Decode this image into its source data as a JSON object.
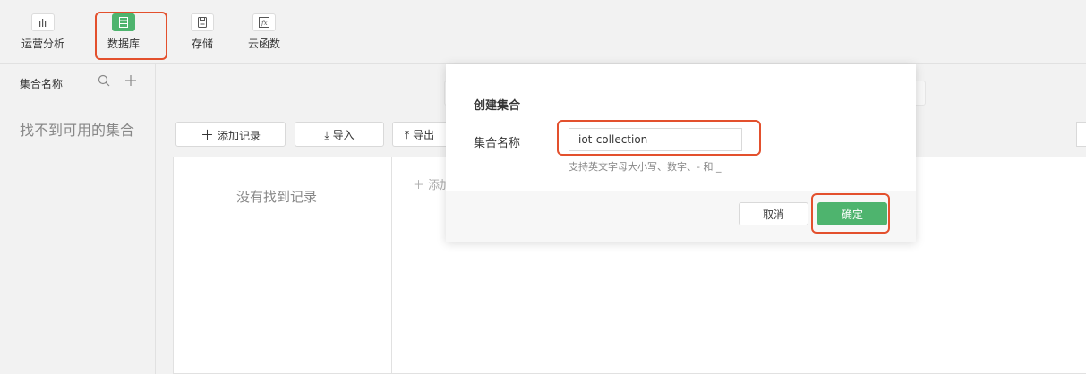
{
  "toolbar": {
    "items": [
      {
        "label": "运营分析",
        "icon": "chart-bars-icon"
      },
      {
        "label": "数据库",
        "icon": "database-icon",
        "active": true
      },
      {
        "label": "存储",
        "icon": "save-disk-icon"
      },
      {
        "label": "云函数",
        "icon": "function-fx-icon"
      }
    ],
    "fx_glyph": "fx"
  },
  "sidebar": {
    "title": "集合名称",
    "empty_text": "找不到可用的集合"
  },
  "main": {
    "add_record_label": "添加记录",
    "import_label": "导入",
    "export_label": "导出",
    "empty_records_text": "没有找到记录",
    "add_field_label": "添加"
  },
  "modal": {
    "title": "创建集合",
    "field_label": "集合名称",
    "field_value": "iot-collection",
    "hint": "支持英文字母大小写、数字、- 和 _",
    "cancel_label": "取消",
    "confirm_label": "确定"
  },
  "colors": {
    "accent_green": "#4eb46e",
    "highlight_red": "#e3502d"
  }
}
